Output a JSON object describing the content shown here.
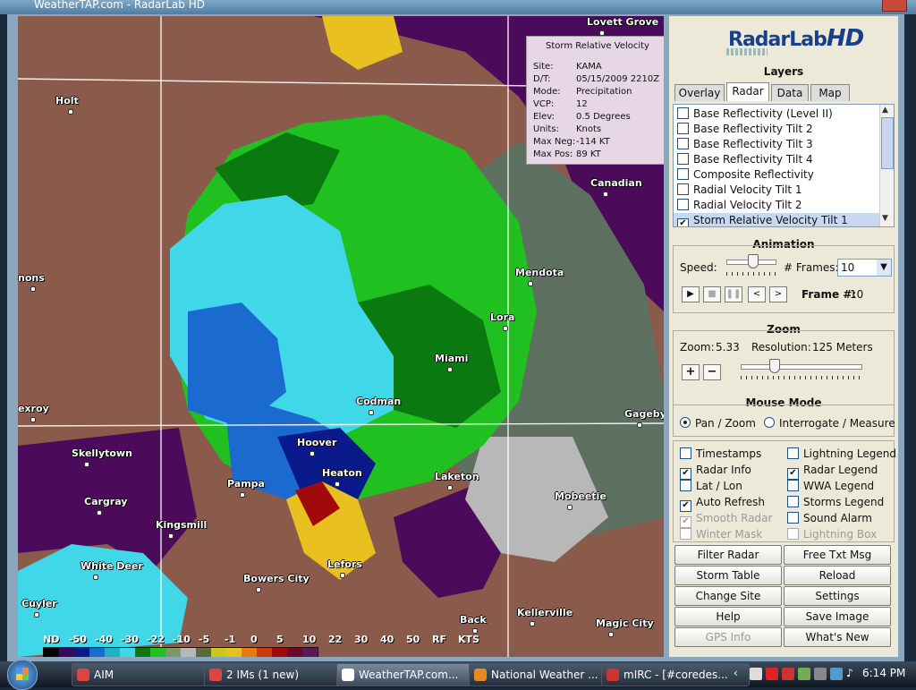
{
  "window": {
    "title": "WeatherTAP.com - RadarLab HD"
  },
  "map": {
    "cities": [
      {
        "name": "Holt"
      },
      {
        "name": "Canadian"
      },
      {
        "name": "Mendota"
      },
      {
        "name": "Lora"
      },
      {
        "name": "Miami"
      },
      {
        "name": "Codman"
      },
      {
        "name": "Hoover"
      },
      {
        "name": "Heaton"
      },
      {
        "name": "Skellytown"
      },
      {
        "name": "Pampa"
      },
      {
        "name": "Laketon"
      },
      {
        "name": "Cargray"
      },
      {
        "name": "Kingsmill"
      },
      {
        "name": "Mobeetie"
      },
      {
        "name": "White Deer"
      },
      {
        "name": "Lefors"
      },
      {
        "name": "Bowers City"
      },
      {
        "name": "Cuyler"
      },
      {
        "name": "Kellerville"
      },
      {
        "name": "Magic City"
      },
      {
        "name": "Gageby"
      },
      {
        "name": "Lovett Grove"
      },
      {
        "name": "exroy"
      },
      {
        "name": "nons"
      },
      {
        "name": "Back"
      }
    ],
    "legend": {
      "labels": [
        "ND",
        "-50",
        "-40",
        "-30",
        "-22",
        "-10",
        "-5",
        "-1",
        "0",
        "5",
        "10",
        "22",
        "30",
        "40",
        "50",
        "RF",
        "KTS"
      ],
      "colors": [
        "#000000",
        "#3a0a5a",
        "#0a1a8a",
        "#1a6ad0",
        "#20b0c8",
        "#40d8e8",
        "#0a7a10",
        "#20c020",
        "#7a9a6a",
        "#b8b8b8",
        "#5a6a3a",
        "#c8c820",
        "#e8c020",
        "#e87a10",
        "#c83a10",
        "#a00a0a",
        "#6a0a2a",
        "#5a1a5a"
      ]
    },
    "colors": {
      "purple": "#4b0a5a",
      "brown": "#8a5a4a",
      "green": "#20c020",
      "darkgreen": "#0a7a10",
      "cyan": "#40d8e8",
      "blue": "#1a6ad0",
      "navy": "#0a1a8a",
      "gray": "#5e7060",
      "lightgray": "#b8b8b8",
      "yellow": "#e8c020"
    }
  },
  "infobox": {
    "header": "Storm Relative Velocity",
    "rows": [
      {
        "k": "Site:",
        "v": "KAMA"
      },
      {
        "k": "D/T:",
        "v": "05/15/2009 2210Z"
      },
      {
        "k": "Mode:",
        "v": "Precipitation"
      },
      {
        "k": "VCP:",
        "v": "12"
      },
      {
        "k": "Elev:",
        "v": "0.5 Degrees"
      },
      {
        "k": "Units:",
        "v": "Knots"
      },
      {
        "k": "Max Neg:",
        "v": "-114 KT"
      },
      {
        "k": "Max Pos:",
        "v": "89 KT"
      }
    ]
  },
  "panel": {
    "logo": {
      "text": "RadarLab",
      "suffix": "HD"
    },
    "layers_title": "Layers",
    "tabs": [
      "Overlay",
      "Radar",
      "Data",
      "Map"
    ],
    "active_tab": "Radar",
    "layers": [
      {
        "label": "Base Reflectivity (Level II)",
        "checked": false
      },
      {
        "label": "Base Reflectivity Tilt 2",
        "checked": false
      },
      {
        "label": "Base Reflectivity Tilt 3",
        "checked": false
      },
      {
        "label": "Base Reflectivity Tilt 4",
        "checked": false
      },
      {
        "label": "Composite Reflectivity",
        "checked": false
      },
      {
        "label": "Radial Velocity Tilt 1",
        "checked": false
      },
      {
        "label": "Radial Velocity Tilt 2",
        "checked": false
      },
      {
        "label": "Storm Relative Velocity Tilt 1",
        "checked": true
      }
    ],
    "animation": {
      "title": "Animation",
      "speed_label": "Speed:",
      "frames_label": "# Frames:",
      "frames_value": "10",
      "frame_num_label": "Frame #:",
      "frame_num": "10"
    },
    "zoom": {
      "title": "Zoom",
      "zoom_label": "Zoom:",
      "zoom_value": "5.33",
      "resolution_label": "Resolution:",
      "resolution_value": "125 Meters"
    },
    "mouse_mode": {
      "title": "Mouse Mode",
      "opt1": "Pan / Zoom",
      "opt2": "Interrogate / Measure"
    },
    "options": [
      {
        "label": "Timestamps",
        "checked": false,
        "disabled": false
      },
      {
        "label": "Lightning Legend",
        "checked": false,
        "disabled": false
      },
      {
        "label": "Radar Info",
        "checked": true,
        "disabled": false
      },
      {
        "label": "Radar Legend",
        "checked": true,
        "disabled": false
      },
      {
        "label": "Lat / Lon",
        "checked": false,
        "disabled": false
      },
      {
        "label": "WWA Legend",
        "checked": false,
        "disabled": false
      },
      {
        "label": "Auto Refresh",
        "checked": true,
        "disabled": false
      },
      {
        "label": "Storms Legend",
        "checked": false,
        "disabled": false
      },
      {
        "label": "Smooth Radar",
        "checked": true,
        "disabled": true
      },
      {
        "label": "Sound Alarm",
        "checked": false,
        "disabled": false
      },
      {
        "label": "Winter Mask",
        "checked": false,
        "disabled": true
      },
      {
        "label": "Lightning Box",
        "checked": false,
        "disabled": true
      }
    ],
    "buttons": [
      {
        "label": "Filter Radar",
        "disabled": false
      },
      {
        "label": "Free Txt Msg",
        "disabled": false
      },
      {
        "label": "Storm Table",
        "disabled": false
      },
      {
        "label": "Reload",
        "disabled": false
      },
      {
        "label": "Change Site",
        "disabled": false
      },
      {
        "label": "Settings",
        "disabled": false
      },
      {
        "label": "Help",
        "disabled": false
      },
      {
        "label": "Save Image",
        "disabled": false
      },
      {
        "label": "GPS Info",
        "disabled": true
      },
      {
        "label": "What's New",
        "disabled": false
      }
    ]
  },
  "taskbar": {
    "items": [
      "AIM",
      "2 IMs (1 new)",
      "WeatherTAP.com...",
      "National Weather ...",
      "mIRC - [#coredes..."
    ],
    "active": "WeatherTAP.com...",
    "clock": "6:14 PM"
  }
}
